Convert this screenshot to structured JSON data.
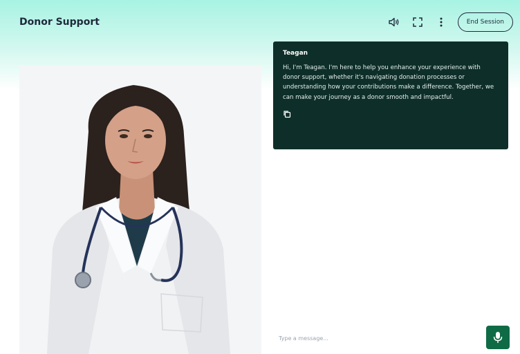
{
  "header": {
    "title": "Donor Support",
    "end_session_label": "End Session",
    "icons": [
      "volume-icon",
      "fullscreen-icon",
      "more-vertical-icon"
    ]
  },
  "chat": {
    "messages": [
      {
        "sender": "Teagan",
        "text": "Hi, I'm Teagan. I'm here to help you enhance your experience with donor support, whether it's navigating donation processes or understanding how your contributions make a difference. Together, we can make your journey as a donor smooth and impactful."
      }
    ]
  },
  "composer": {
    "placeholder": "Type a message..."
  },
  "colors": {
    "accent": "#0f6b45",
    "bubble_bg": "#0e2f29",
    "header_gradient": "#a7f3e3"
  }
}
